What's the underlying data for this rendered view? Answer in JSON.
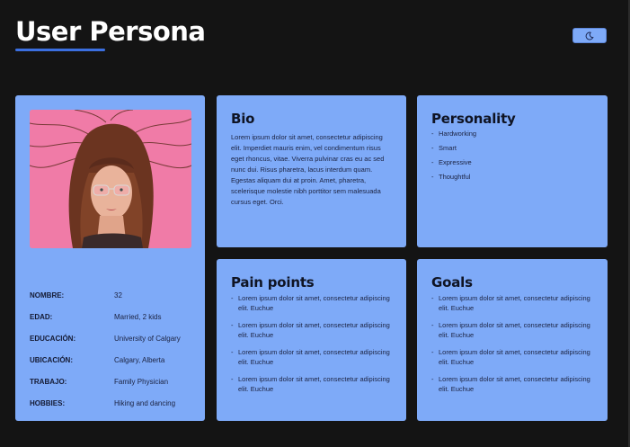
{
  "header": {
    "title": "User Persona"
  },
  "theme_toggle": {
    "icon": "moon-icon"
  },
  "profile": {
    "photo_alt": "",
    "fields": [
      {
        "label": "NOMBRE:",
        "value": "32"
      },
      {
        "label": "EDAD:",
        "value": "Married, 2 kids"
      },
      {
        "label": "EDUCACIÓN:",
        "value": "University of Calgary"
      },
      {
        "label": "UBICACIÓN:",
        "value": "Calgary, Alberta"
      },
      {
        "label": "TRABAJO:",
        "value": "Family Physician"
      },
      {
        "label": "HOBBIES:",
        "value": "Hiking and dancing"
      }
    ]
  },
  "bio": {
    "title": "Bio",
    "text": "Lorem ipsum dolor sit amet, consectetur adipiscing elit. Imperdiet mauris enim, vel condimentum risus eget rhoncus, vitae. Viverra pulvinar cras eu ac sed nunc dui. Risus pharetra, lacus interdum quam. Egestas aliquam dui at proin. Amet, pharetra, scelerisque molestie nibh porttitor sem malesuada cursus eget. Orci."
  },
  "personality": {
    "title": "Personality",
    "items": [
      "Hardworking",
      "Smart",
      "Expressive",
      "Thoughtful"
    ]
  },
  "pain_points": {
    "title": "Pain points",
    "items": [
      "Lorem ipsum dolor sit amet, consectetur adipiscing elit. Euchue",
      "Lorem ipsum dolor sit amet, consectetur adipiscing elit. Euchue",
      "Lorem ipsum dolor sit amet, consectetur adipiscing elit. Euchue",
      "Lorem ipsum dolor sit amet, consectetur adipiscing elit. Euchue"
    ]
  },
  "goals": {
    "title": "Goals",
    "items": [
      "Lorem ipsum dolor sit amet, consectetur adipiscing elit. Euchue",
      "Lorem ipsum dolor sit amet, consectetur adipiscing elit. Euchue",
      "Lorem ipsum dolor sit amet, consectetur adipiscing elit. Euchue",
      "Lorem ipsum dolor sit amet, consectetur adipiscing elit. Euchue"
    ]
  },
  "colors": {
    "background": "#141414",
    "card": "#7eaaf8",
    "accent": "#3b6fe0",
    "text_dark": "#0f1424"
  }
}
